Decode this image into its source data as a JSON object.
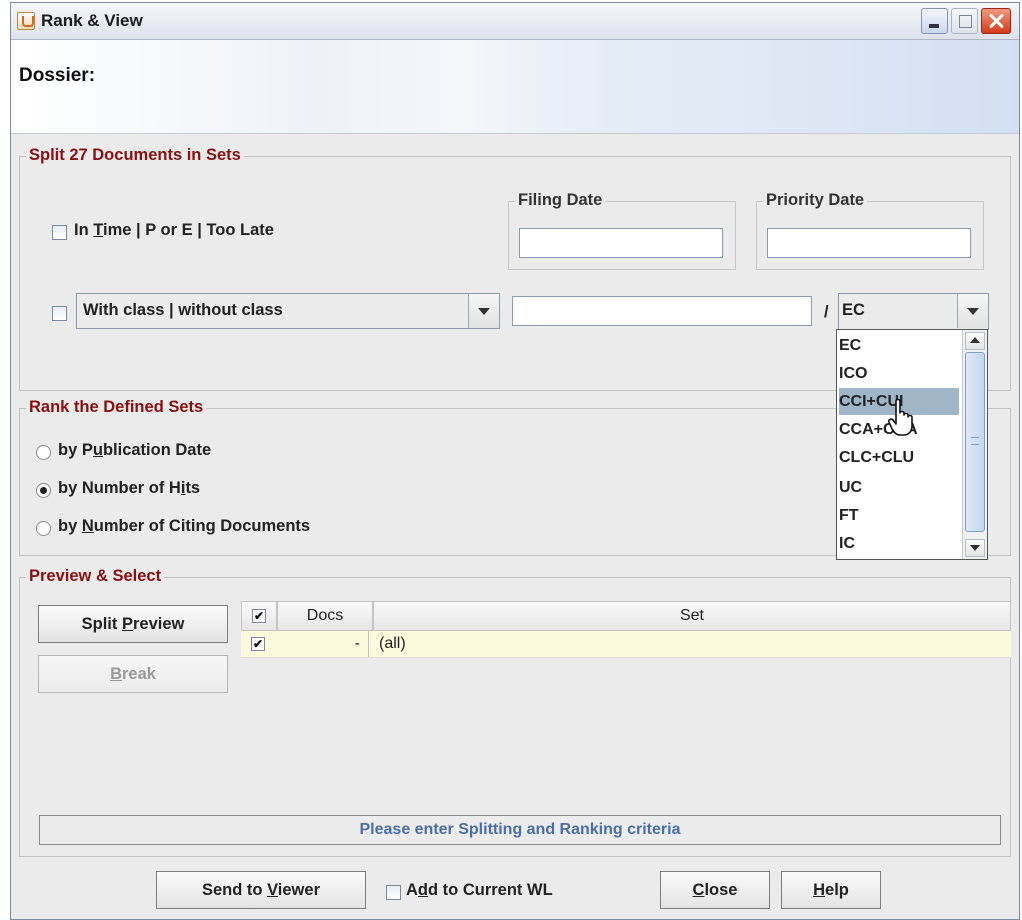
{
  "window": {
    "title": "Rank & View"
  },
  "dossier": {
    "label": "Dossier:"
  },
  "split": {
    "title": "Split 27 Documents in Sets",
    "time_option": {
      "pre": "In ",
      "ul": "T",
      "post": "ime | P or E | Too Late",
      "checked": false
    },
    "filing_date": {
      "label": "Filing Date",
      "value": ""
    },
    "priority_date": {
      "label": "Priority Date",
      "value": ""
    },
    "class_option": {
      "checked": false,
      "combo_value": "With class | without class"
    },
    "class_input": {
      "value": ""
    },
    "separator": "/",
    "class_type": {
      "value": "EC",
      "open": true,
      "options": [
        "EC",
        "ICO",
        "CCI+CUI",
        "CCA+CUA",
        "CLC+CLU",
        "UC",
        "FT",
        "IC"
      ],
      "highlighted": "CCI+CUI"
    }
  },
  "rank": {
    "title": "Rank the Defined Sets",
    "options": [
      {
        "pre": "by P",
        "ul": "u",
        "post": "blication Date",
        "checked": false
      },
      {
        "pre": "by Number of H",
        "ul": "i",
        "post": "ts",
        "checked": true
      },
      {
        "pre": "by ",
        "ul": "N",
        "post": "umber of Citing Documents",
        "checked": false
      }
    ]
  },
  "preview": {
    "title": "Preview & Select",
    "split_preview": {
      "pre": "Split ",
      "ul": "P",
      "post": "review",
      "enabled": true
    },
    "break": {
      "pre": "",
      "ul": "B",
      "post": "reak",
      "enabled": false
    },
    "table": {
      "columns": [
        "",
        "Docs",
        "Set"
      ],
      "header_checked": true,
      "rows": [
        {
          "checked": true,
          "docs": "-",
          "set": "(all)"
        }
      ]
    },
    "status": "Please enter Splitting and Ranking criteria"
  },
  "footer": {
    "send": {
      "pre": "Send to ",
      "ul": "V",
      "post": "iewer"
    },
    "add_wl": {
      "pre": "A",
      "ul": "d",
      "post": "d to Current WL",
      "checked": false
    },
    "close": {
      "pre": "",
      "ul": "C",
      "post": "lose"
    },
    "help": {
      "pre": "",
      "ul": "H",
      "post": "elp"
    }
  },
  "colors": {
    "group_title": "#8b0f0f",
    "status_text": "#4a6fa8",
    "row_highlight": "#fdf9dd",
    "dropdown_selection": "#9fb5c8"
  }
}
